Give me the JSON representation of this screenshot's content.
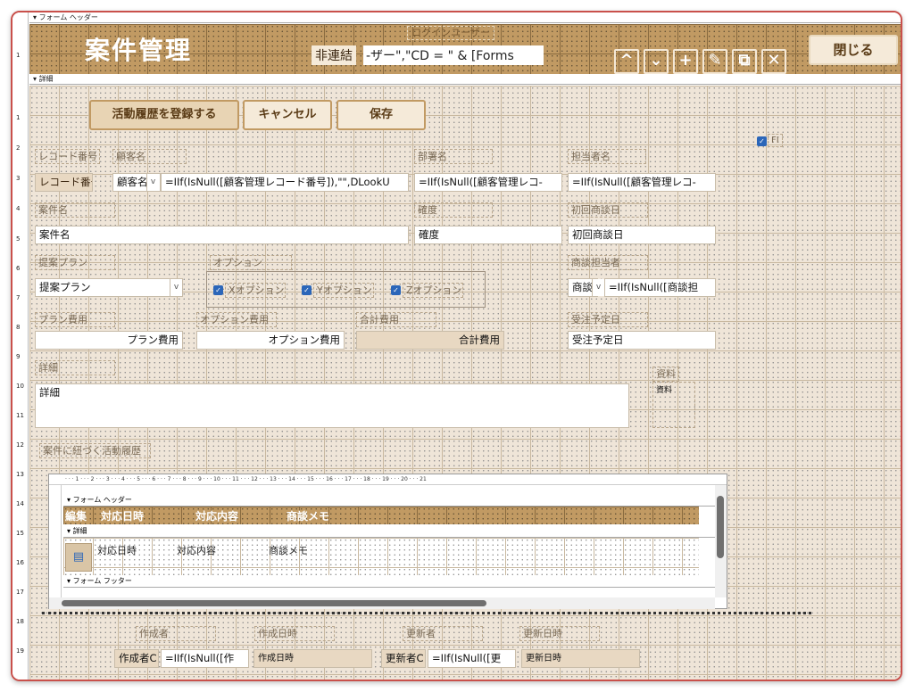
{
  "sections": {
    "header": "フォーム ヘッダー",
    "detail": "詳細",
    "sub_header": "フォーム ヘッダー",
    "sub_detail": "詳細",
    "sub_footer": "フォーム フッター"
  },
  "header": {
    "title": "案件管理",
    "login_label": "ログインユーザー",
    "unbound_label": "非連結",
    "login_expr": "-ザー\",\"CD = \" & [Forms",
    "close_label": "閉じる",
    "nav_icons": [
      "chevron-up-icon",
      "chevron-down-icon",
      "plus-icon",
      "pencil-icon",
      "copy-icon",
      "close-icon"
    ],
    "nav_glyphs": [
      "^",
      "⌄",
      "+",
      "✎",
      "⧉",
      "✕"
    ]
  },
  "buttons": {
    "register_activity": "活動履歴を登録する",
    "cancel": "キャンセル",
    "save": "保存"
  },
  "fields": {
    "record_no_label": "レコード番号",
    "record_no_value": "レコード番号",
    "customer_label": "顧客名",
    "customer_combo": "顧客名",
    "customer_expr": "=IIf(IsNull([顧客管理レコード番号]),\"\",DLookU",
    "dept_label": "部署名",
    "dept_expr": "=IIf(IsNull([顧客管理レコ-",
    "owner_label": "担当者名",
    "owner_expr": "=IIf(IsNull([顧客管理レコ-",
    "fi_label": "FI",
    "case_label": "案件名",
    "case_value": "案件名",
    "certainty_label": "確度",
    "certainty_value": "確度",
    "first_meeting_label": "初回商談日",
    "first_meeting_value": "初回商談日",
    "plan_label": "提案プラン",
    "plan_value": "提案プラン",
    "option_label": "オプション",
    "opt_x": "Xオプション",
    "opt_y": "Yオプション",
    "opt_z": "Zオプション",
    "sales_rep_label": "商談担当者",
    "sales_rep_combo": "商談",
    "sales_rep_expr": "=IIf(IsNull([商談担",
    "plan_cost_label": "プラン費用",
    "plan_cost_value": "プラン費用",
    "option_cost_label": "オプション費用",
    "option_cost_value": "オプション費用",
    "total_cost_label": "合計費用",
    "total_cost_value": "合計費用",
    "order_date_label": "受注予定日",
    "order_date_value": "受注予定日",
    "detail_label": "詳細",
    "detail_value": "詳細",
    "material_label": "資料",
    "material_value": "資料",
    "related_label": "案件に紐づく活動履歴",
    "creator_label": "作成者",
    "created_at_label": "作成日時",
    "updater_label": "更新者",
    "updated_at_label": "更新日時",
    "creator_code": "作成者C",
    "creator_expr": "=IIf(IsNull([作",
    "created_at_value": "作成日時",
    "updater_code": "更新者C",
    "updater_expr": "=IIf(IsNull([更",
    "updated_at_value": "更新日時"
  },
  "subform": {
    "headers": [
      "編集",
      "対応日時",
      "対応内容",
      "商談メモ"
    ],
    "row": [
      "対応日時",
      "対応内容",
      "商談メモ"
    ],
    "ruler": [
      "1",
      "2",
      "3",
      "4",
      "5",
      "6",
      "7",
      "8",
      "9",
      "10",
      "11",
      "12",
      "13",
      "14",
      "15",
      "16",
      "17",
      "18",
      "19",
      "20",
      "21"
    ]
  },
  "ruler": [
    "1",
    "2",
    "3",
    "4",
    "5",
    "6",
    "7",
    "8",
    "9",
    "10",
    "11",
    "12",
    "13",
    "14",
    "15",
    "16",
    "17",
    "18",
    "19"
  ],
  "colors": {
    "accent": "#c19a63",
    "border": "#c9504b",
    "checkbox": "#2b66b9"
  }
}
